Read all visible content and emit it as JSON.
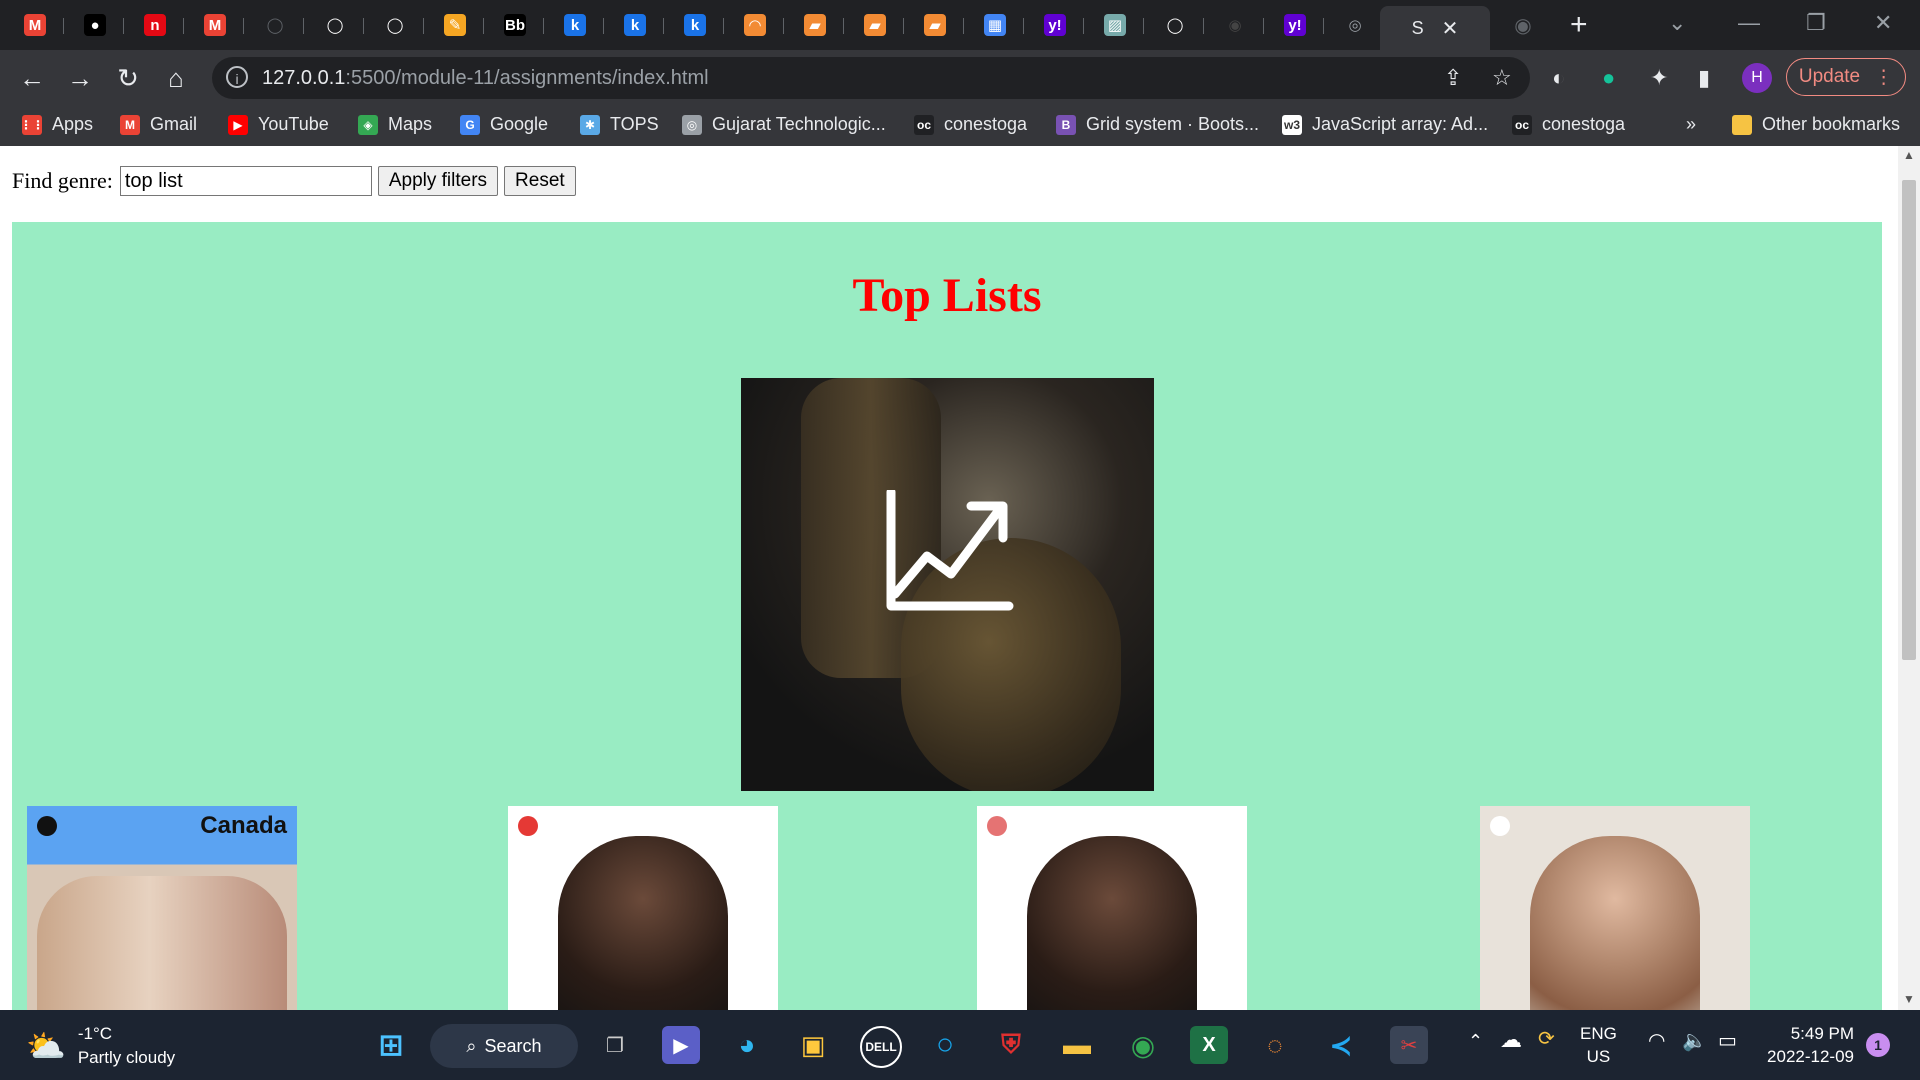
{
  "browser": {
    "tabs": [
      {
        "icon": "gmail-icon",
        "glyph": "M",
        "color": "#ea4335"
      },
      {
        "icon": "medium-icon",
        "glyph": "●",
        "color": "#000000"
      },
      {
        "icon": "netflix-icon",
        "glyph": "n",
        "color": "#e50914"
      },
      {
        "icon": "gmail-icon",
        "glyph": "M",
        "color": "#ea4335"
      },
      {
        "icon": "github-icon",
        "glyph": "◯",
        "color": "#5f6368"
      },
      {
        "icon": "github-icon",
        "glyph": "◯",
        "color": "#ffffff"
      },
      {
        "icon": "github-icon",
        "glyph": "◯",
        "color": "#ffffff"
      },
      {
        "icon": "pencil-icon",
        "glyph": "✎",
        "color": "#f5a623"
      },
      {
        "icon": "bb-icon",
        "glyph": "Bb",
        "color": "#000000"
      },
      {
        "icon": "k-icon",
        "glyph": "k",
        "color": "#1a73e8"
      },
      {
        "icon": "k-icon",
        "glyph": "k",
        "color": "#1a73e8"
      },
      {
        "icon": "k-icon",
        "glyph": "k",
        "color": "#1a73e8"
      },
      {
        "icon": "loading-icon",
        "glyph": "◠",
        "color": "#f28b34"
      },
      {
        "icon": "book-icon",
        "glyph": "▰",
        "color": "#f28b34"
      },
      {
        "icon": "book-icon",
        "glyph": "▰",
        "color": "#f28b34"
      },
      {
        "icon": "book-icon",
        "glyph": "▰",
        "color": "#f28b34"
      },
      {
        "icon": "squares-icon",
        "glyph": "▦",
        "color": "#4285f4"
      },
      {
        "icon": "yahoo-icon",
        "glyph": "y!",
        "color": "#6001d2"
      },
      {
        "icon": "image-icon",
        "glyph": "▨",
        "color": "#7aa"
      },
      {
        "icon": "github-icon",
        "glyph": "◯",
        "color": "#ffffff"
      },
      {
        "icon": "spotify-icon",
        "glyph": "◉",
        "color": "#444444"
      },
      {
        "icon": "yahoo-icon",
        "glyph": "y!",
        "color": "#6001d2"
      },
      {
        "icon": "globe-icon",
        "glyph": "◎",
        "color": "#9aa0a6"
      }
    ],
    "active_tab": {
      "label": "S",
      "icon": "globe-icon"
    },
    "after_tab_icon": "spotify-icon",
    "url_host": "127.0.0.1",
    "url_path": ":5500/module-11/assignments/index.html",
    "update_label": "Update",
    "avatar_letter": "H"
  },
  "bookmarks": [
    {
      "label": "Apps",
      "icon": "apps-grid-icon",
      "color": "#ea4335"
    },
    {
      "label": "Gmail",
      "icon": "gmail-icon",
      "color": "#ea4335"
    },
    {
      "label": "YouTube",
      "icon": "youtube-icon",
      "color": "#ff0000"
    },
    {
      "label": "Maps",
      "icon": "maps-pin-icon",
      "color": "#34a853"
    },
    {
      "label": "Google",
      "icon": "google-icon",
      "color": "#4285f4"
    },
    {
      "label": "TOPS",
      "icon": "tops-icon",
      "color": "#5aa9e6"
    },
    {
      "label": "Gujarat Technologic...",
      "icon": "globe-icon",
      "color": "#9aa0a6"
    },
    {
      "label": "conestoga",
      "icon": "oc-icon",
      "color": "#202124"
    },
    {
      "label": "Grid system · Boots...",
      "icon": "bootstrap-icon",
      "color": "#7952b3"
    },
    {
      "label": "JavaScript array: Ad...",
      "icon": "w3schools-icon",
      "color": "#ffffff"
    },
    {
      "label": "conestoga",
      "icon": "oc-icon",
      "color": "#202124"
    }
  ],
  "bookmarks_more": "»",
  "other_bookmarks": "Other bookmarks",
  "page": {
    "filter_label": "Find genre:",
    "filter_value": "top list",
    "apply_label": "Apply filters",
    "reset_label": "Reset",
    "heading": "Top Lists",
    "cards": [
      {
        "banner": "Canada",
        "bg": "#d9c7b6",
        "top": "#5ba3f2",
        "logo": "#111111"
      },
      {
        "banner": "",
        "bg": "#ffffff",
        "top": "#ffffff",
        "logo": "#e53935"
      },
      {
        "banner": "",
        "bg": "#ffffff",
        "top": "#ffffff",
        "logo": "#e57373"
      },
      {
        "banner": "",
        "bg": "#e8e2da",
        "top": "#e8e2da",
        "logo": "#ffffff"
      }
    ]
  },
  "taskbar": {
    "temp": "-1°C",
    "condition": "Partly cloudy",
    "search_label": "Search",
    "lang_top": "ENG",
    "lang_bottom": "US",
    "time": "5:49 PM",
    "date": "2022-12-09",
    "notification_count": "1"
  }
}
